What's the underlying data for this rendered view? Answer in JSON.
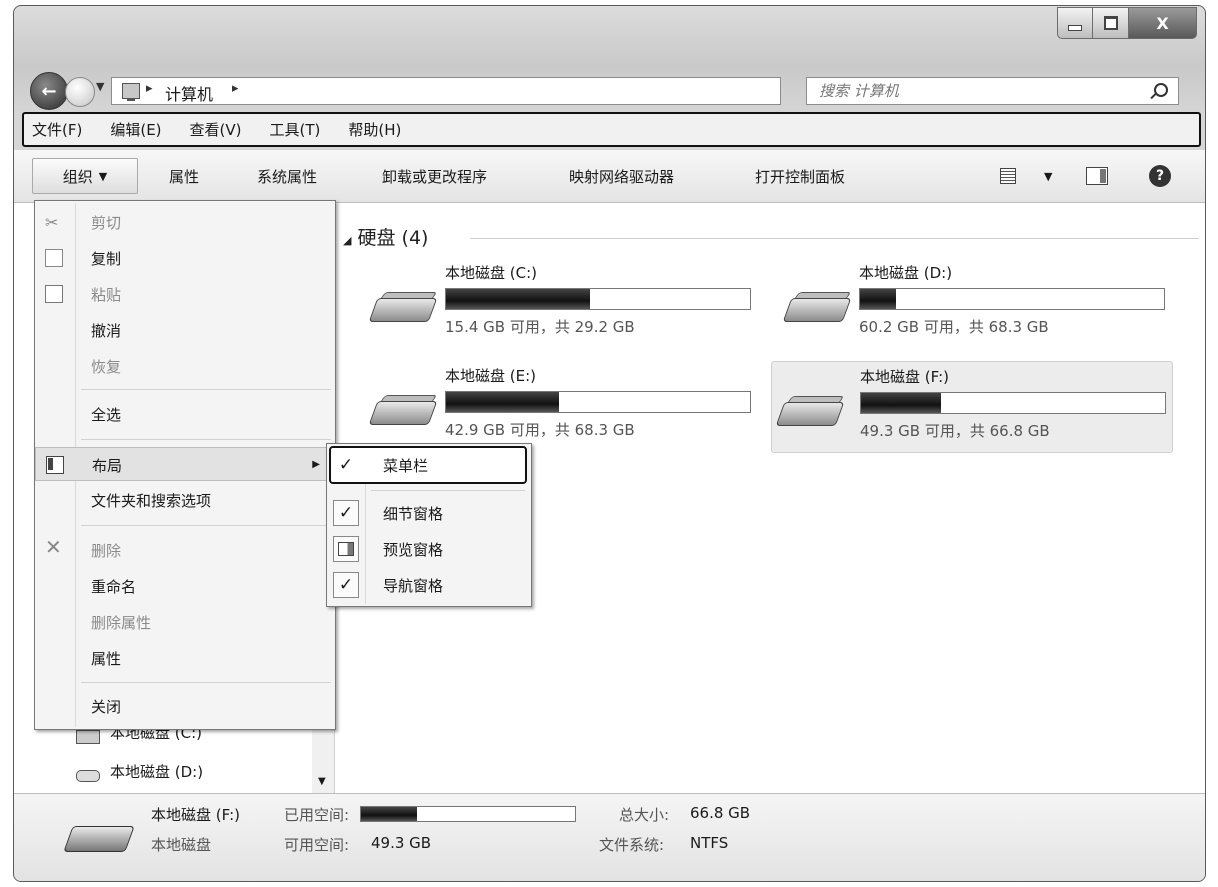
{
  "window": {
    "close_glyph": "X"
  },
  "address": {
    "back_glyph": "←",
    "breadcrumb": [
      "计算机"
    ],
    "search_placeholder": "搜索 计算机"
  },
  "menubar": {
    "items": [
      "文件(F)",
      "编辑(E)",
      "查看(V)",
      "工具(T)",
      "帮助(H)"
    ]
  },
  "commandbar": {
    "organize_label": "组织",
    "items": [
      "属性",
      "系统属性",
      "卸载或更改程序",
      "映射网络驱动器",
      "打开控制面板"
    ],
    "help_glyph": "?"
  },
  "organize_menu": {
    "items": [
      {
        "label": "剪切",
        "icon": "scissors-icon",
        "enabled": false
      },
      {
        "label": "复制",
        "icon": "copy-icon",
        "enabled": true
      },
      {
        "label": "粘贴",
        "icon": "paste-icon",
        "enabled": false
      },
      {
        "label": "撤消",
        "enabled": true
      },
      {
        "label": "恢复",
        "enabled": false
      },
      {
        "label": "全选",
        "enabled": true
      },
      {
        "label": "布局",
        "icon": "layout-icon",
        "enabled": true,
        "submenu": true
      },
      {
        "label": "文件夹和搜索选项",
        "enabled": true
      },
      {
        "label": "删除",
        "icon": "delete-icon",
        "enabled": false
      },
      {
        "label": "重命名",
        "enabled": true
      },
      {
        "label": "删除属性",
        "enabled": false
      },
      {
        "label": "属性",
        "enabled": true
      },
      {
        "label": "关闭",
        "enabled": true
      }
    ]
  },
  "layout_submenu": {
    "items": [
      {
        "label": "菜单栏",
        "checked": true
      },
      {
        "label": "细节窗格",
        "checked": true
      },
      {
        "label": "预览窗格",
        "checked": false
      },
      {
        "label": "导航窗格",
        "checked": true
      }
    ],
    "check_glyph": "✓"
  },
  "navigation": {
    "items": [
      "本地磁盘 (C:)",
      "本地磁盘 (D:)"
    ]
  },
  "content": {
    "group_header": "硬盘 (4)",
    "drives": [
      {
        "name": "本地磁盘 (C:)",
        "size_text": "15.4 GB 可用，共 29.2 GB",
        "used_fraction": 0.473
      },
      {
        "name": "本地磁盘 (D:)",
        "size_text": "60.2 GB 可用，共 68.3 GB",
        "used_fraction": 0.119
      },
      {
        "name": "本地磁盘 (E:)",
        "size_text": "42.9 GB 可用，共 68.3 GB",
        "used_fraction": 0.372
      },
      {
        "name": "本地磁盘 (F:)",
        "size_text": "49.3 GB 可用，共 66.8 GB",
        "used_fraction": 0.262
      }
    ]
  },
  "details": {
    "name": "本地磁盘 (F:)",
    "type": "本地磁盘",
    "used_label": "已用空间:",
    "used_fraction": 0.262,
    "free_label": "可用空间:",
    "free_value": "49.3 GB",
    "total_label": "总大小:",
    "total_value": "66.8 GB",
    "fs_label": "文件系统:",
    "fs_value": "NTFS"
  },
  "glyphs": {
    "dropdown": "▼",
    "submenu": "▶",
    "collapse": "◢",
    "crumb_sep": "▸"
  }
}
